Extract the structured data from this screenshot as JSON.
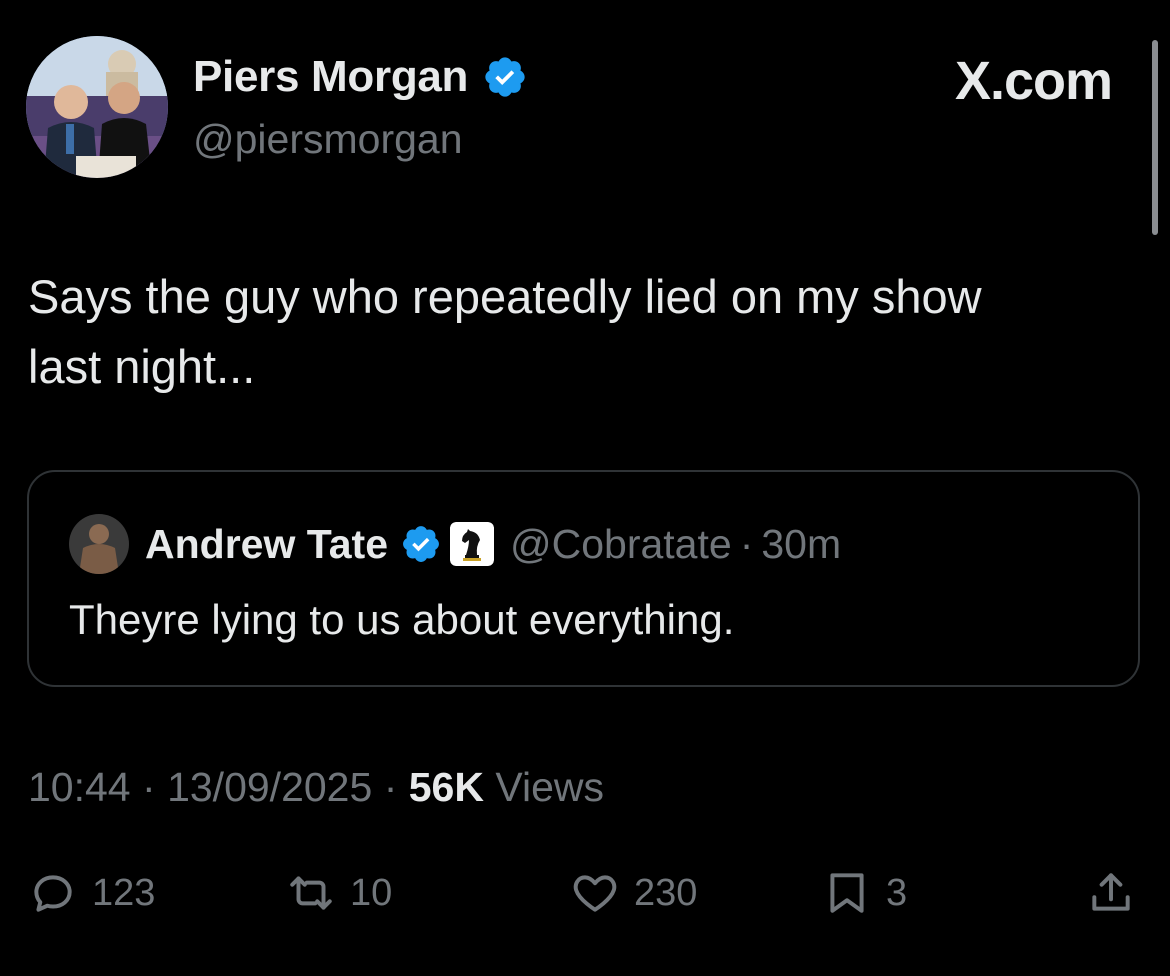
{
  "author": {
    "name": "Piers Morgan",
    "handle": "@piersmorgan",
    "verified": true
  },
  "source_label": "X.com",
  "tweet": {
    "text_line1": "Says the guy who repeatedly lied on my show",
    "text_line2": "last night..."
  },
  "quoted": {
    "name": "Andrew Tate",
    "handle": "@Cobratate",
    "separator": "·",
    "time": "30m",
    "text": "Theyre lying to us about everything."
  },
  "meta": {
    "time": "10:44",
    "sep1": "·",
    "date": "13/09/2025",
    "sep2": "·",
    "views_count": "56K",
    "views_label": "Views"
  },
  "actions": {
    "replies": "123",
    "reposts": "10",
    "likes": "230",
    "bookmarks": "3"
  },
  "colors": {
    "background": "#000000",
    "text_primary": "#e7e9ea",
    "text_secondary": "#71767b",
    "verified_blue": "#1d9bf0",
    "border": "#2f3336"
  }
}
